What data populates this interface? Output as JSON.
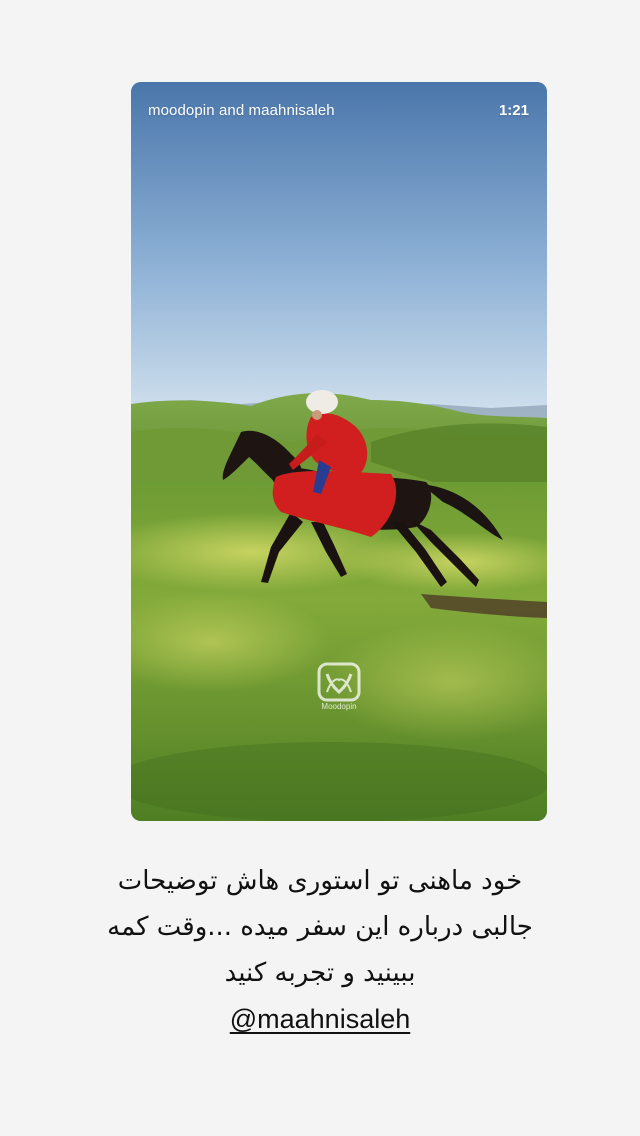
{
  "video": {
    "users": "moodopin and maahnisaleh",
    "duration": "1:21",
    "watermark_text": "Moodopin",
    "watermark_icon": "moodopin-logo-icon"
  },
  "caption": {
    "line1": "خود ماهنی تو استوری هاش توضیحات",
    "line2": "جالبی درباره این سفر میده ...وقت کمه",
    "line3": "ببینید و تجربه کنید",
    "mention": "@maahnisaleh"
  },
  "colors": {
    "background": "#f4f4f4",
    "sky_top": "#4a76ab",
    "sky_bottom": "#c9dbe9",
    "grass": "#6c9a2e",
    "rider_red": "#d11f1f",
    "text": "#111111"
  }
}
